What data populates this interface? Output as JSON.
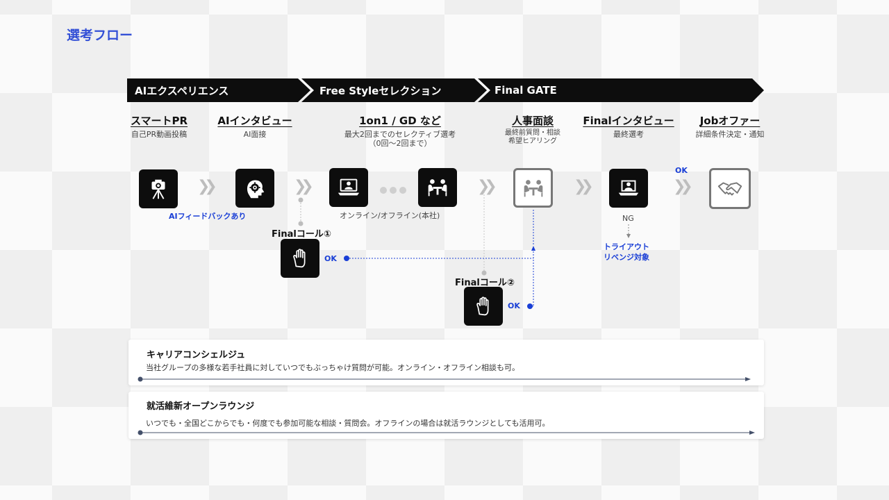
{
  "title": "選考フロー",
  "phases": [
    "AIエクスペリエンス",
    "Free Styleセレクション",
    "Final GATE"
  ],
  "steps": [
    {
      "title": "スマートPR",
      "sub": [
        "自己PR動画投稿"
      ]
    },
    {
      "title": "AIインタビュー",
      "sub": [
        "AI面接"
      ]
    },
    {
      "title": "1on1 / GD など",
      "sub": [
        "最大2回までのセレクティブ選考",
        "（0回〜2回まで）"
      ]
    },
    {
      "title": "人事面談",
      "sub": [
        "最終前質問・相談",
        "希望ヒアリング"
      ]
    },
    {
      "title": "Finalインタビュー",
      "sub": [
        "最終選考"
      ]
    },
    {
      "title": "Jobオファー",
      "sub": [
        "詳細条件決定・通知"
      ]
    }
  ],
  "icons": [
    "camera-tripod-icon",
    "ai-head-gear-icon",
    "laptop-video-call-icon",
    "people-table-icon",
    "people-table-outline-icon",
    "laptop-user-icon",
    "handshake-icon",
    "raised-hand-icon"
  ],
  "labels": {
    "ai_feedback": "AIフィードバックあり",
    "online_offline": "オンライン/オフライン(本社)",
    "final_call_1": "Finalコール①",
    "final_call_2": "Finalコール②",
    "ok": "OK",
    "ng": "NG",
    "tryout_line1": "トライアウト",
    "tryout_line2": "リベンジ対象"
  },
  "cards": [
    {
      "title": "キャリアコンシェルジュ",
      "desc": "当社グループの多様な若手社員に対していつでもぶっちゃけ質問が可能。オンライン・オフライン相談も可。"
    },
    {
      "title": "就活維新オープンラウンジ",
      "desc": "いつでも・全国どこからでも・何度でも参加可能な相談・質問会。オフラインの場合は就活ラウンジとしても活用可。"
    }
  ],
  "colors": {
    "accent_blue": "#1a3fd6",
    "title_blue": "#3350d6",
    "phase_black": "#0d0d0d",
    "chevron_gray": "#bdbdbd"
  }
}
